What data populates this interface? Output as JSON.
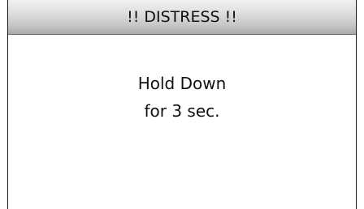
{
  "dialog": {
    "title": "!! DISTRESS !!",
    "message_line_1": "Hold Down",
    "message_line_2": "for 3 sec."
  },
  "colors": {
    "background": "#ffffff",
    "title_bar_top": "#f2f2f2",
    "title_bar_bottom": "#a8a8a8",
    "text": "#111111",
    "frame": "#1a1a1a"
  }
}
